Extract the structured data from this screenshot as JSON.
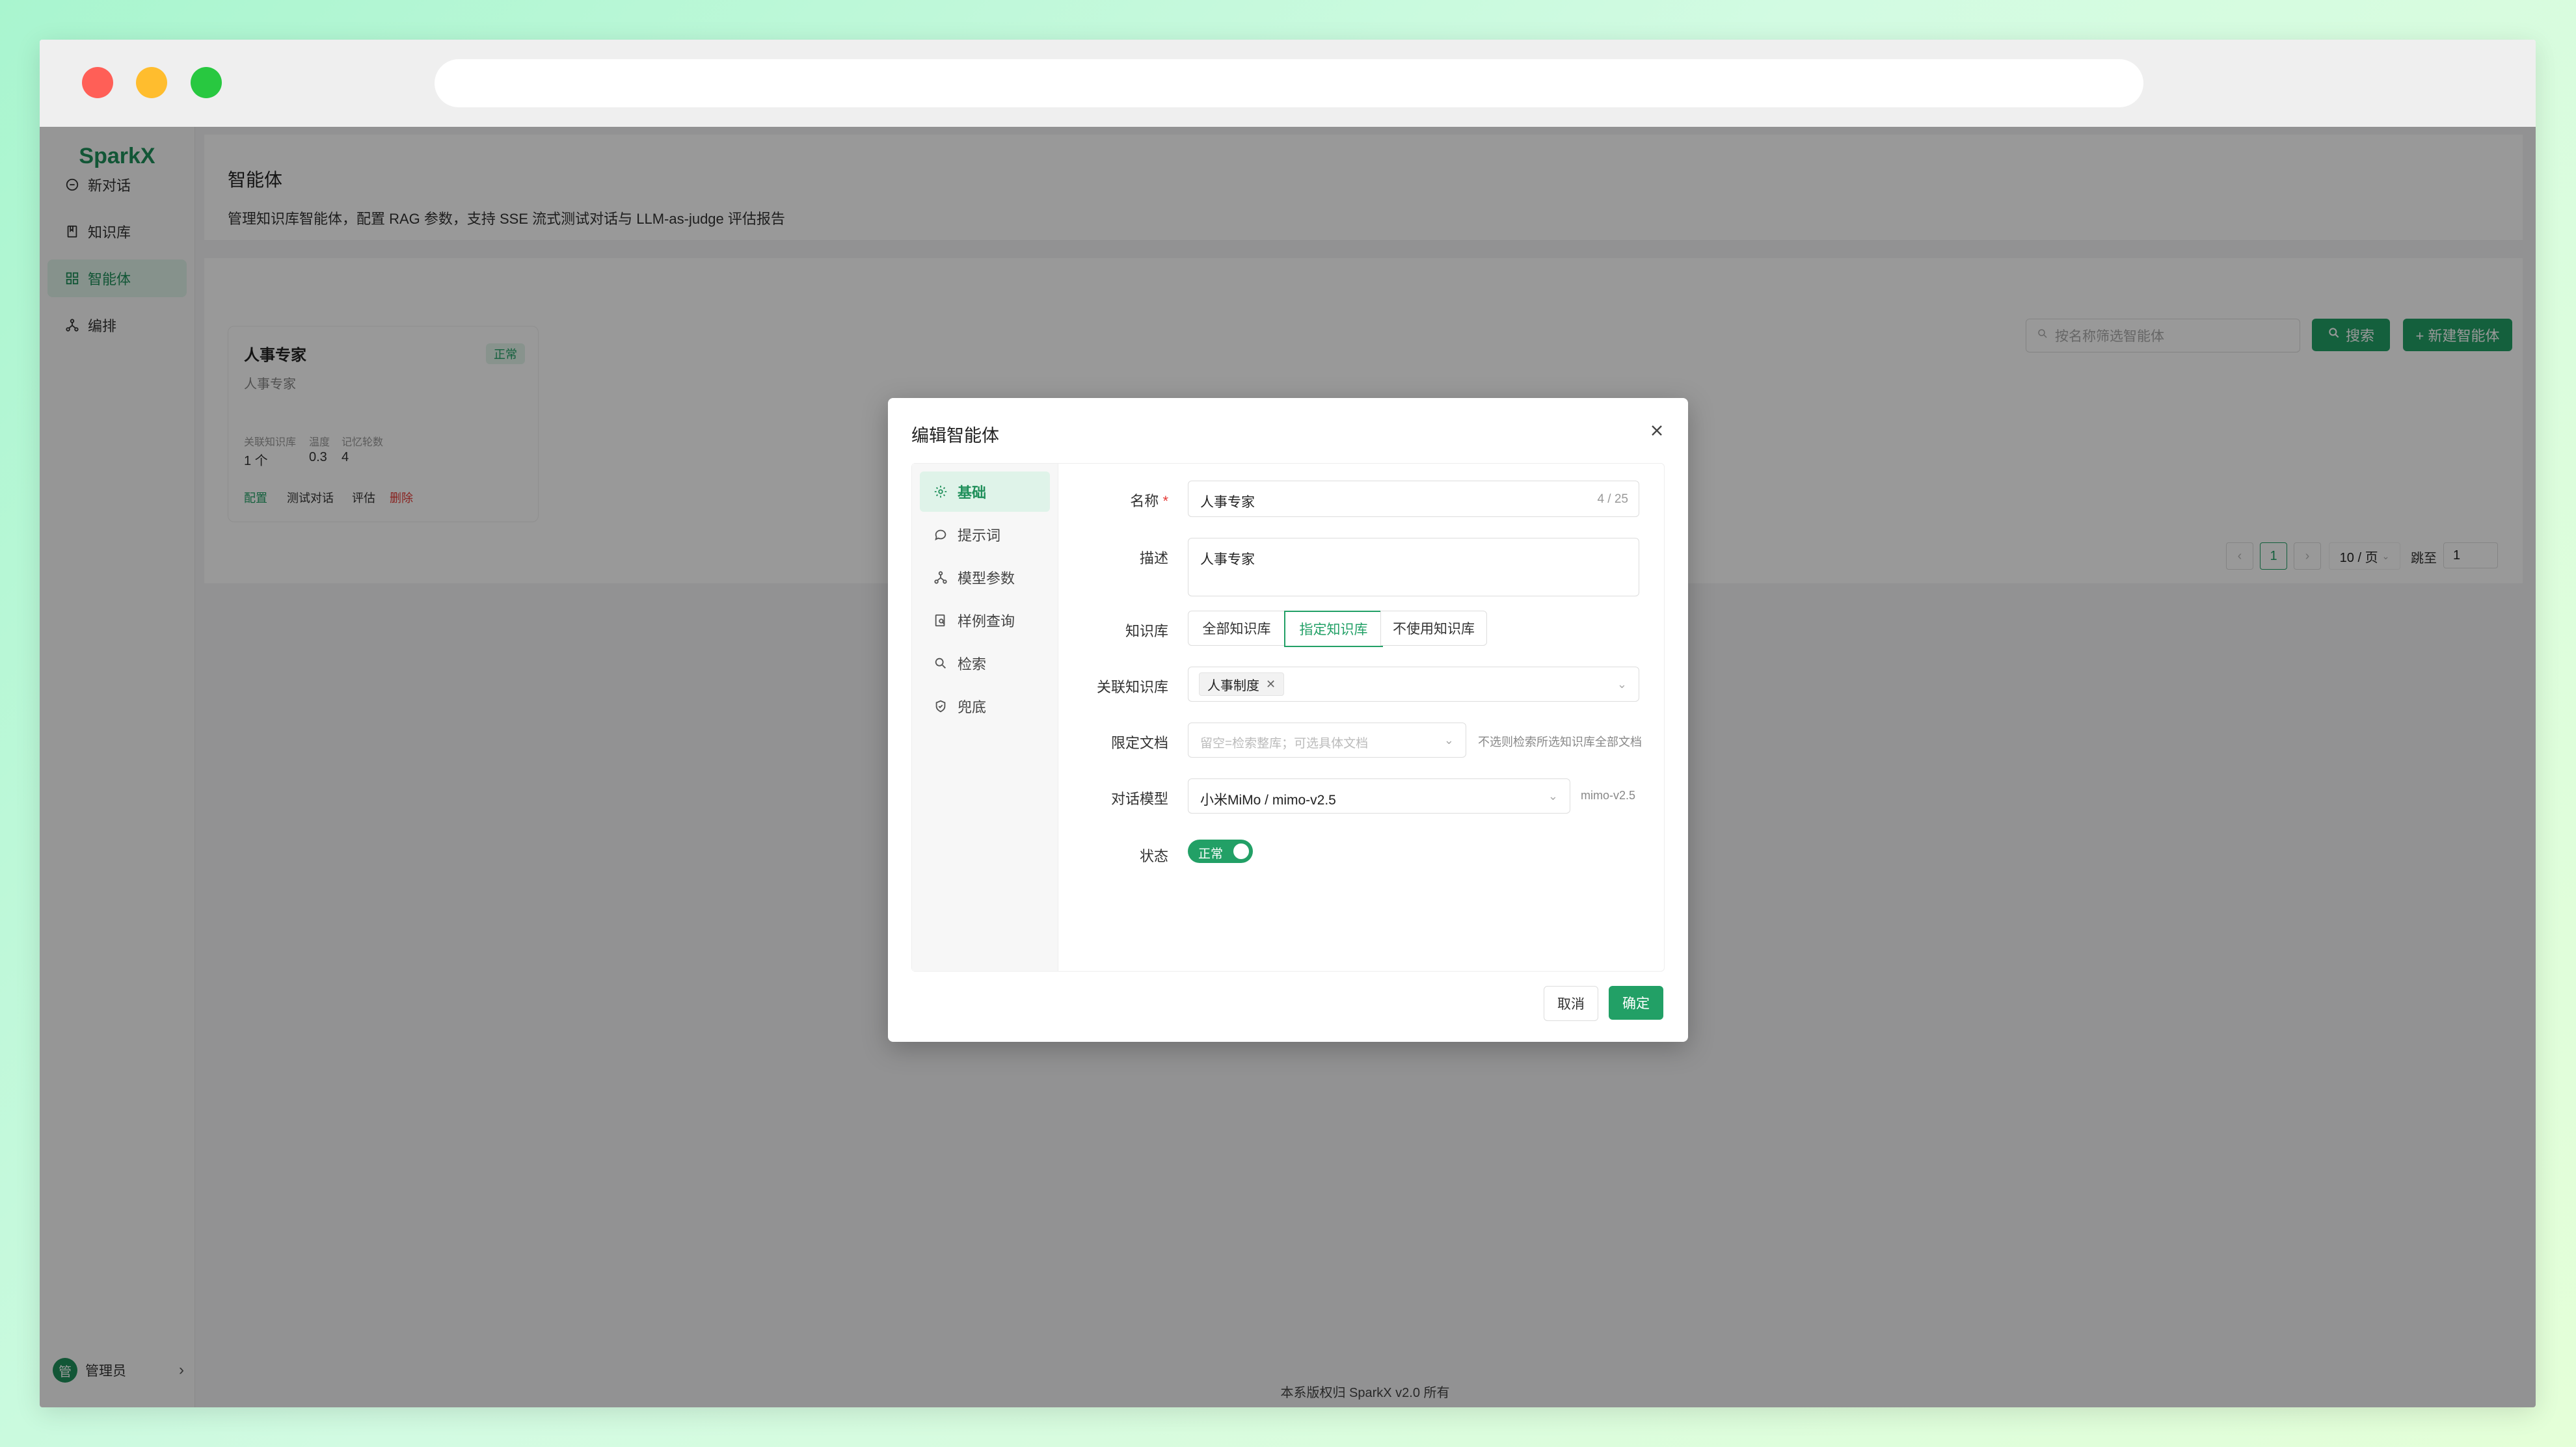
{
  "app": {
    "logo": "SparkX",
    "nav": [
      {
        "label": "新对话",
        "icon": "chat-icon"
      },
      {
        "label": "知识库",
        "icon": "book-icon"
      },
      {
        "label": "智能体",
        "icon": "grid-icon"
      },
      {
        "label": "编排",
        "icon": "flow-icon"
      }
    ],
    "active_nav": "智能体",
    "user": {
      "avatar": "管",
      "name": "管理员"
    },
    "footer": "本系版权归 SparkX v2.0 所有"
  },
  "page": {
    "title": "智能体",
    "description": "管理知识库智能体，配置 RAG 参数，支持 SSE 流式测试对话与 LLM-as-judge 评估报告",
    "search_placeholder": "按名称筛选智能体",
    "search_button": "搜索",
    "new_button": "+ 新建智能体"
  },
  "agent_card": {
    "name": "人事专家",
    "status": "正常",
    "description": "人事专家",
    "stats": [
      {
        "label": "关联知识库",
        "value": "1 个"
      },
      {
        "label": "温度",
        "value": "0.3"
      },
      {
        "label": "记忆轮数",
        "value": "4"
      }
    ],
    "actions": [
      "配置",
      "测试对话",
      "评估",
      "删除"
    ]
  },
  "pagination": {
    "current": "1",
    "page_size": "10 / 页",
    "jump_label": "跳至",
    "jump_value": "1"
  },
  "modal": {
    "title": "编辑智能体",
    "tabs": [
      {
        "label": "基础",
        "icon": "gear-icon"
      },
      {
        "label": "提示词",
        "icon": "message-icon"
      },
      {
        "label": "模型参数",
        "icon": "network-icon"
      },
      {
        "label": "样例查询",
        "icon": "doc-search-icon"
      },
      {
        "label": "检索",
        "icon": "search-icon"
      },
      {
        "label": "兜底",
        "icon": "shield-icon"
      }
    ],
    "active_tab": "基础",
    "form": {
      "name_label": "名称",
      "name_value": "人事专家",
      "name_counter": "4 / 25",
      "desc_label": "描述",
      "desc_value": "人事专家",
      "kb_label": "知识库",
      "kb_options": [
        "全部知识库",
        "指定知识库",
        "不使用知识库"
      ],
      "kb_selected": "指定知识库",
      "linked_label": "关联知识库",
      "linked_tag": "人事制度",
      "doc_label": "限定文档",
      "doc_placeholder": "留空=检索整库；可选具体文档",
      "doc_hint": "不选则检索所选知识库全部文档",
      "model_label": "对话模型",
      "model_value": "小米MiMo / mimo-v2.5",
      "model_hint": "mimo-v2.5",
      "status_label": "状态",
      "status_value": "正常"
    },
    "cancel": "取消",
    "confirm": "确定"
  },
  "colors": {
    "brand": "#22a066",
    "brand_light": "#dff3e9",
    "danger": "#e53935"
  }
}
